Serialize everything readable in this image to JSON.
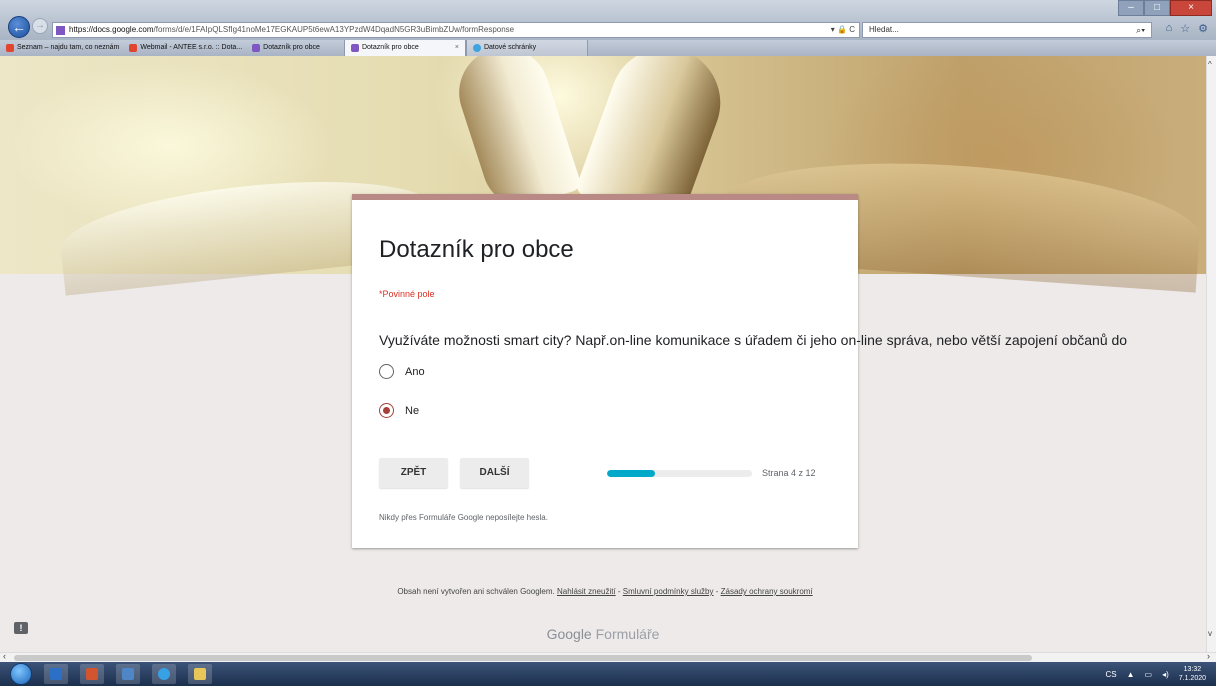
{
  "browser": {
    "url_host": "https://docs.google.com",
    "url_path": "/forms/d/e/1FAIpQLSfIg41noMe17EGKAUP5t6ewA13YPzdW4DqadN5GR3uBimbZUw/formResponse",
    "address_controls": "▾ 🔒 C",
    "search_placeholder": "Hledat...",
    "favorites": [
      {
        "label": "Seznam – najdu tam, co neznám"
      },
      {
        "label": "Webmail - ANTEE s.r.o. :: Dota..."
      },
      {
        "label": "Dotazník pro obce"
      }
    ],
    "tabs": [
      {
        "label": "Dotazník pro obce",
        "close": "×"
      },
      {
        "label": "Datové schránky"
      }
    ]
  },
  "form": {
    "title": "Dotazník pro obce",
    "required_note": "*Povinné pole",
    "question": "Využíváte možnosti smart city? Např.on-line komunikace s úřadem či jeho on-line správa, nebo větší zapojení občanů do",
    "options": [
      {
        "label": "Ano",
        "selected": false
      },
      {
        "label": "Ne",
        "selected": true
      }
    ],
    "back_label": "ZPĚT",
    "next_label": "DALŠÍ",
    "progress_text": "Strana 4 z 12",
    "progress_fraction": 0.333,
    "password_note": "Nikdy přes Formuláře Google neposílejte hesla.",
    "accent_color": "#a5403b",
    "progress_color": "#03a9c9"
  },
  "footer": {
    "disclaimer": "Obsah není vytvořen ani schválen Googlem.",
    "link_abuse": "Nahlásit zneužití",
    "link_terms": "Smluvní podmínky služby",
    "link_privacy": "Zásady ochrany soukromí",
    "separator": " - ",
    "brand_google": "Google",
    "brand_forms": "Formuláře"
  },
  "taskbar": {
    "lang": "CS",
    "time": "13:32",
    "date": "7.1.2020"
  }
}
